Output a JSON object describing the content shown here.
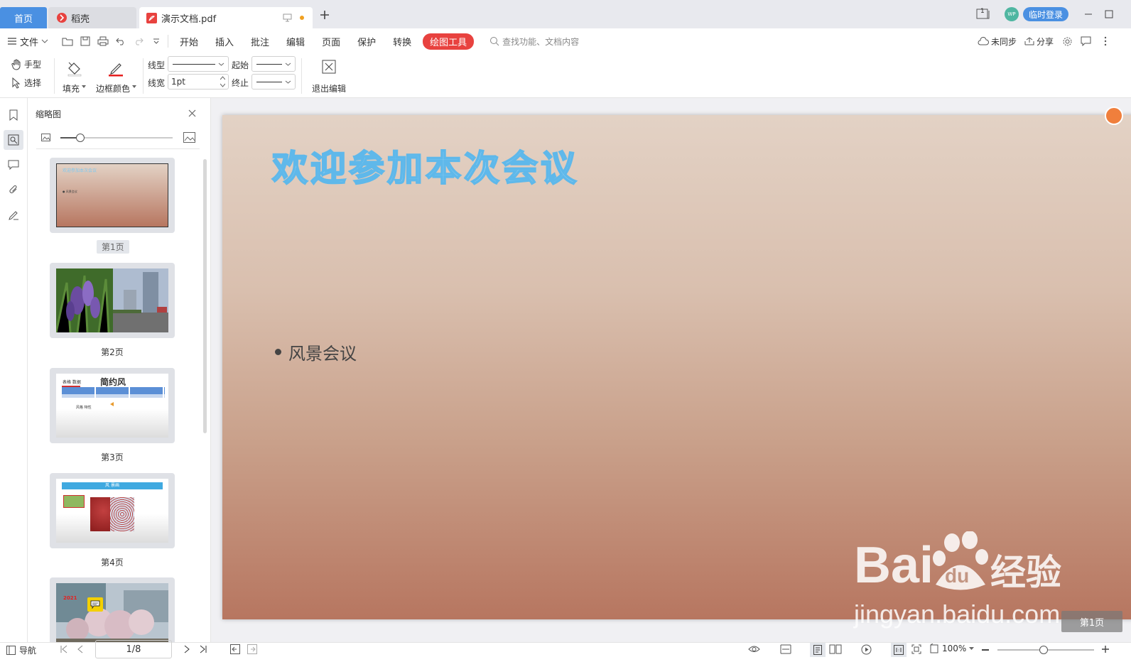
{
  "tabs": {
    "home": "首页",
    "daoke": "稻壳",
    "doc": "演示文档.pdf",
    "login": "临时登录",
    "avatar": "WP",
    "screen_badge": "1"
  },
  "menu": {
    "file": "文件",
    "items": [
      "开始",
      "插入",
      "批注",
      "编辑",
      "页面",
      "保护",
      "转换"
    ],
    "active": "绘图工具",
    "search_placeholder": "查找功能、文档内容",
    "sync": "未同步",
    "share": "分享"
  },
  "ribbon": {
    "hand": "手型",
    "select": "选择",
    "fill": "填充",
    "border_color": "边框颜色",
    "line_type": "线型",
    "line_width": "线宽",
    "line_width_value": "1pt",
    "start": "起始",
    "end": "终止",
    "exit_edit": "退出编辑"
  },
  "panel": {
    "title": "缩略图",
    "thumbs": [
      "第1页",
      "第2页",
      "第3页",
      "第4页"
    ],
    "t1_title": "欢迎参加本次会议",
    "t1_bullet": "● 风景会议",
    "t3_label": "表格 数据",
    "t3_title": "简约风",
    "t3_text": "风格 特性",
    "t4_title": "风 景画",
    "t5_year": "2021"
  },
  "slide": {
    "title": "欢迎参加本次会议",
    "bullet": "风景会议",
    "watermark_domain": "jingyan.baidu.com",
    "watermark_jy": "经验",
    "page_tag": "第1页"
  },
  "status": {
    "nav": "导航",
    "page": "1/8",
    "zoom": "100%"
  },
  "colors": {
    "accent": "#4a90e2",
    "draw_tool_tab": "#e8423f",
    "slide_title": "#7ec8f0"
  }
}
